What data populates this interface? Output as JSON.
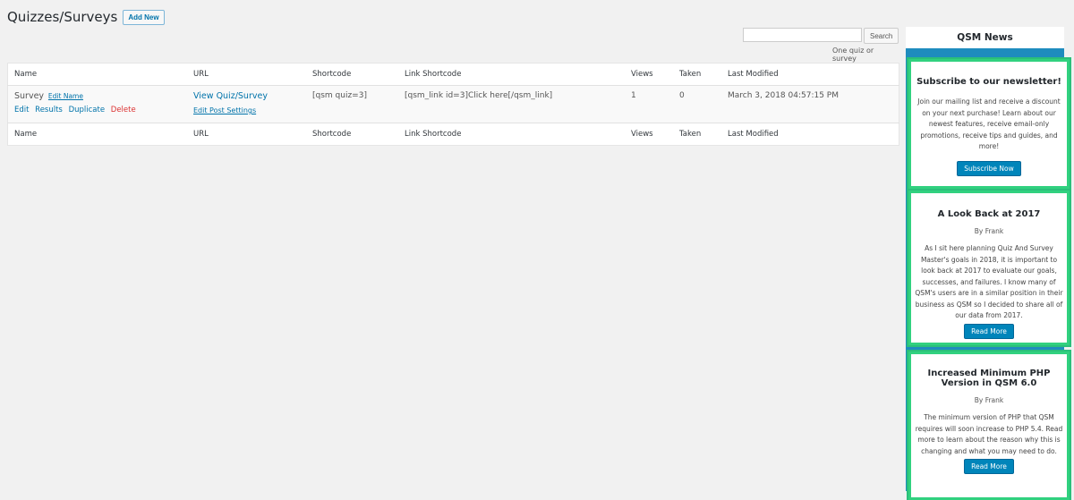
{
  "header": {
    "title": "Quizzes/Surveys",
    "add_new": "Add New"
  },
  "search": {
    "button": "Search",
    "hint": "One quiz or survey",
    "value": ""
  },
  "table": {
    "columns": [
      "Name",
      "URL",
      "Shortcode",
      "Link Shortcode",
      "Views",
      "Taken",
      "Last Modified"
    ],
    "rows": [
      {
        "name": "Survey",
        "edit_name": "Edit Name",
        "actions": {
          "edit": "Edit",
          "results": "Results",
          "duplicate": "Duplicate",
          "delete": "Delete"
        },
        "url_label": "View Quiz/Survey",
        "post_settings": "Edit Post Settings",
        "shortcode": "[qsm quiz=3]",
        "link_shortcode": "[qsm_link id=3]Click here[/qsm_link]",
        "views": "1",
        "taken": "0",
        "modified": "March 3, 2018 04:57:15 PM"
      }
    ]
  },
  "news": {
    "title": "QSM News",
    "cards": [
      {
        "title": "Subscribe to our newsletter!",
        "body": "Join our mailing list and receive a discount on your next purchase! Learn about our newest features, receive email-only promotions, receive tips and guides, and more!",
        "button": "Subscribe Now"
      },
      {
        "title": "A Look Back at 2017",
        "byline": "By Frank",
        "body": "As I sit here planning Quiz And Survey Master's goals in 2018, it is important to look back at 2017 to evaluate our goals, successes, and failures. I know many of QSM's users are in a similar position in their business as QSM so I decided to share all of our data from 2017.",
        "button": "Read More"
      },
      {
        "title": "Increased Minimum PHP Version in QSM 6.0",
        "byline": "By Frank",
        "body": "The minimum version of PHP that QSM requires will soon increase to PHP 5.4. Read more to learn about the reason why this is changing and what you may need to do.",
        "button": "Read More"
      }
    ]
  }
}
